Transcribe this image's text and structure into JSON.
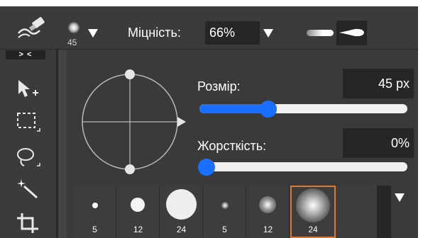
{
  "options_bar": {
    "tool_icon": "brush-stroke-icon",
    "brush_size": "45",
    "strength_label": "Міцність:",
    "strength_value": "66%"
  },
  "toolbar": {
    "collapse_label": "> <",
    "tools": [
      "move-add-icon",
      "rect-marquee-icon",
      "lasso-icon",
      "magic-wand-icon",
      "crop-icon"
    ]
  },
  "brush_panel": {
    "size_label": "Розмір:",
    "size_value": "45 px",
    "size_fraction": 0.33,
    "hardness_label": "Жорсткість:",
    "hardness_value": "0%",
    "hardness_fraction": 0.0
  },
  "presets": [
    {
      "size": "5",
      "style": "hard"
    },
    {
      "size": "12",
      "style": "hard"
    },
    {
      "size": "24",
      "style": "hard"
    },
    {
      "size": "5",
      "style": "soft"
    },
    {
      "size": "12",
      "style": "soft"
    },
    {
      "size": "24",
      "style": "soft",
      "selected": true
    }
  ],
  "colors": {
    "accent": "#1b6fff",
    "selection": "#d97a3a",
    "panel": "#3a3a3a",
    "field": "#262626"
  }
}
